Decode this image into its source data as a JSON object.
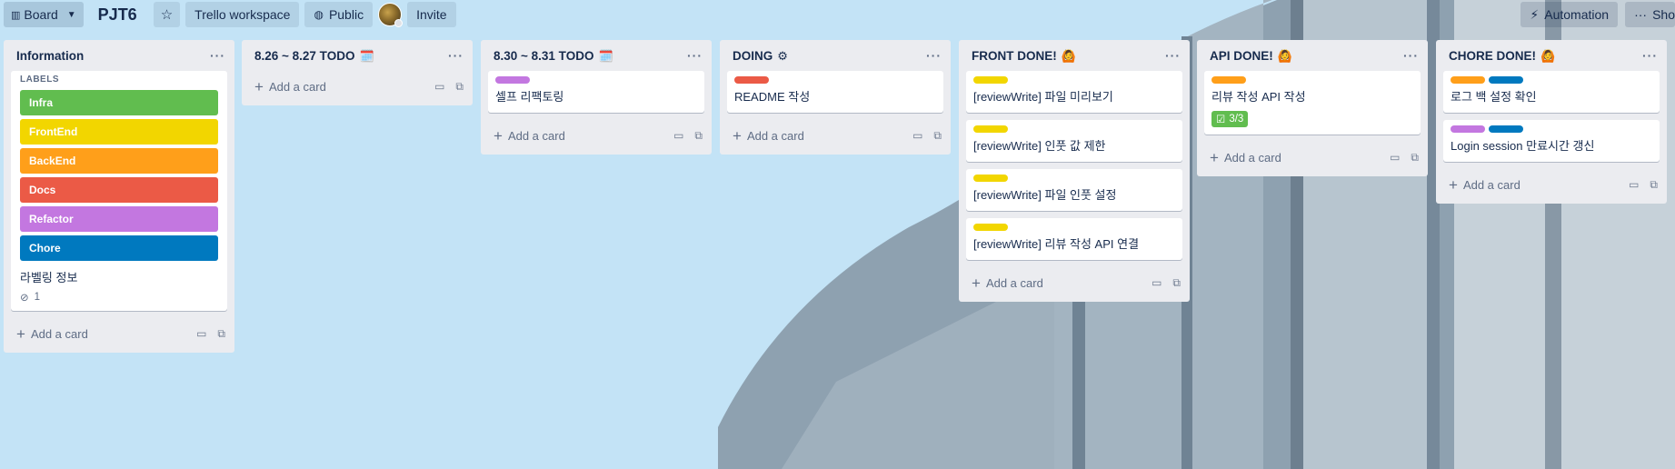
{
  "header": {
    "view_label": "Board",
    "board_title": "PJT6",
    "workspace_label": "Trello workspace",
    "visibility_label": "Public",
    "invite_label": "Invite",
    "automation_label": "Automation",
    "show_menu_label": "Sho"
  },
  "colors": {
    "green": "#61bd4f",
    "yellow": "#f2d600",
    "orange": "#ff9f1a",
    "red": "#eb5a46",
    "purple": "#c377e0",
    "blue": "#0079bf"
  },
  "lists": {
    "info": {
      "title": "Information",
      "card_heading": "LABELS",
      "labels": [
        "Infra",
        "FrontEnd",
        "BackEnd",
        "Docs",
        "Refactor",
        "Chore"
      ],
      "card_text": "라벨링 정보",
      "attachment_count": "1"
    },
    "todo1": {
      "title": "8.26 ~ 8.27 TODO",
      "emoji": "🗓️"
    },
    "todo2": {
      "title": "8.30 ~ 8.31 TODO",
      "emoji": "🗓️",
      "cards": [
        "셀프 리팩토링"
      ]
    },
    "doing": {
      "title": "DOING",
      "emoji": "⚙",
      "cards": [
        "README 작성"
      ]
    },
    "front": {
      "title": "FRONT DONE!",
      "emoji": "🙆",
      "cards": [
        "[reviewWrite] 파일 미리보기",
        "[reviewWrite] 인풋 값 제한",
        "[reviewWrite] 파일 인풋 설정",
        "[reviewWrite] 리뷰 작성 API 연결"
      ]
    },
    "api": {
      "title": "API DONE!",
      "emoji": "🙆",
      "cards": [
        "리뷰 작성 API 작성"
      ],
      "checklist": "3/3"
    },
    "chore": {
      "title": "CHORE DONE!",
      "emoji": "🙆",
      "cards": [
        "로그 백 설정 확인",
        "Login session 만료시간 갱신"
      ]
    }
  },
  "add_card_label": "Add a card",
  "icons": [
    "board-icon",
    "chevron-down-icon",
    "star-icon",
    "globe-icon",
    "bolt-icon",
    "more-icon",
    "plus-icon",
    "template-icon",
    "copy-icon",
    "paperclip-icon",
    "checklist-icon"
  ]
}
